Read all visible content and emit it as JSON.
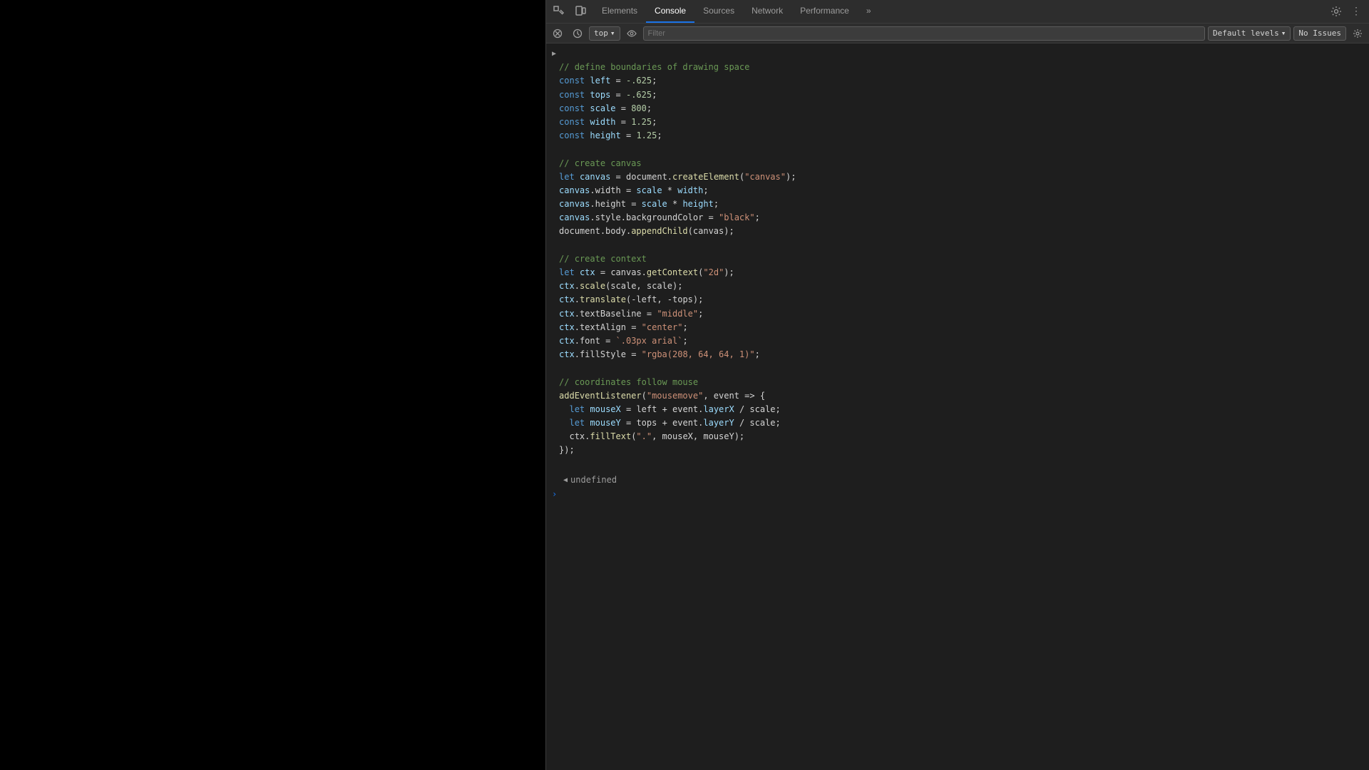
{
  "page": {
    "canvas_bg": "#000000"
  },
  "devtools": {
    "tabs": [
      {
        "id": "elements",
        "label": "Elements",
        "active": false
      },
      {
        "id": "console",
        "label": "Console",
        "active": true
      },
      {
        "id": "sources",
        "label": "Sources",
        "active": false
      },
      {
        "id": "network",
        "label": "Network",
        "active": false
      },
      {
        "id": "performance",
        "label": "Performance",
        "active": false
      }
    ],
    "more_tabs_label": "»",
    "console": {
      "context": "top",
      "filter_placeholder": "Filter",
      "log_levels": "Default levels",
      "log_levels_arrow": "▾",
      "no_issues": "No Issues",
      "settings_icon": "⚙",
      "output": [
        {
          "type": "group",
          "expand": true,
          "lines": [
            {
              "text": "// define boundaries of drawing space",
              "color": "comment"
            },
            {
              "text": "const left = -.625;",
              "parts": [
                {
                  "t": "const ",
                  "c": "keyword"
                },
                {
                  "t": "left",
                  "c": "variable"
                },
                {
                  "t": " = ",
                  "c": "plain"
                },
                {
                  "t": "-.625",
                  "c": "number"
                },
                {
                  "t": ";",
                  "c": "plain"
                }
              ]
            },
            {
              "text": "const tops = -.625;",
              "parts": [
                {
                  "t": "const ",
                  "c": "keyword"
                },
                {
                  "t": "tops",
                  "c": "variable"
                },
                {
                  "t": " = ",
                  "c": "plain"
                },
                {
                  "t": "-.625",
                  "c": "number"
                },
                {
                  "t": ";",
                  "c": "plain"
                }
              ]
            },
            {
              "text": "const scale = 800;",
              "parts": [
                {
                  "t": "const ",
                  "c": "keyword"
                },
                {
                  "t": "scale",
                  "c": "variable"
                },
                {
                  "t": " = ",
                  "c": "plain"
                },
                {
                  "t": "800",
                  "c": "number"
                },
                {
                  "t": ";",
                  "c": "plain"
                }
              ]
            },
            {
              "text": "const width = 1.25;",
              "parts": [
                {
                  "t": "const ",
                  "c": "keyword"
                },
                {
                  "t": "width",
                  "c": "variable"
                },
                {
                  "t": " = ",
                  "c": "plain"
                },
                {
                  "t": "1.25",
                  "c": "number"
                },
                {
                  "t": ";",
                  "c": "plain"
                }
              ]
            },
            {
              "text": "const height = 1.25;",
              "parts": [
                {
                  "t": "const ",
                  "c": "keyword"
                },
                {
                  "t": "height",
                  "c": "variable"
                },
                {
                  "t": " = ",
                  "c": "plain"
                },
                {
                  "t": "1.25",
                  "c": "number"
                },
                {
                  "t": ";",
                  "c": "plain"
                }
              ]
            },
            {
              "text": "",
              "color": "plain"
            },
            {
              "text": "// create canvas",
              "color": "comment"
            },
            {
              "text": "let canvas = document.createElement(\"canvas\");",
              "parts": [
                {
                  "t": "let ",
                  "c": "keyword"
                },
                {
                  "t": "canvas",
                  "c": "variable"
                },
                {
                  "t": " = document.",
                  "c": "plain"
                },
                {
                  "t": "createElement",
                  "c": "function"
                },
                {
                  "t": "(",
                  "c": "plain"
                },
                {
                  "t": "\"canvas\"",
                  "c": "string"
                },
                {
                  "t": ");",
                  "c": "plain"
                }
              ]
            },
            {
              "text": "canvas.width = scale * width;",
              "parts": [
                {
                  "t": "canvas",
                  "c": "variable"
                },
                {
                  "t": ".width = ",
                  "c": "plain"
                },
                {
                  "t": "scale",
                  "c": "variable"
                },
                {
                  "t": " * ",
                  "c": "plain"
                },
                {
                  "t": "width",
                  "c": "variable"
                },
                {
                  "t": ";",
                  "c": "plain"
                }
              ]
            },
            {
              "text": "canvas.height = scale * height;",
              "parts": [
                {
                  "t": "canvas",
                  "c": "variable"
                },
                {
                  "t": ".height = ",
                  "c": "plain"
                },
                {
                  "t": "scale",
                  "c": "variable"
                },
                {
                  "t": " * ",
                  "c": "plain"
                },
                {
                  "t": "height",
                  "c": "variable"
                },
                {
                  "t": ";",
                  "c": "plain"
                }
              ]
            },
            {
              "text": "canvas.style.backgroundColor = \"black\";",
              "parts": [
                {
                  "t": "canvas",
                  "c": "variable"
                },
                {
                  "t": ".style.backgroundColor = ",
                  "c": "plain"
                },
                {
                  "t": "\"black\"",
                  "c": "string"
                },
                {
                  "t": ";",
                  "c": "plain"
                }
              ]
            },
            {
              "text": "document.body.appendChild(canvas);",
              "parts": [
                {
                  "t": "document.body.",
                  "c": "plain"
                },
                {
                  "t": "appendChild",
                  "c": "function"
                },
                {
                  "t": "(canvas);",
                  "c": "plain"
                }
              ]
            },
            {
              "text": "",
              "color": "plain"
            },
            {
              "text": "// create context",
              "color": "comment"
            },
            {
              "text": "let ctx = canvas.getContext(\"2d\");",
              "parts": [
                {
                  "t": "let ",
                  "c": "keyword"
                },
                {
                  "t": "ctx",
                  "c": "variable"
                },
                {
                  "t": " = canvas.",
                  "c": "plain"
                },
                {
                  "t": "getContext",
                  "c": "function"
                },
                {
                  "t": "(",
                  "c": "plain"
                },
                {
                  "t": "\"2d\"",
                  "c": "string"
                },
                {
                  "t": ");",
                  "c": "plain"
                }
              ]
            },
            {
              "text": "ctx.scale(scale, scale);",
              "parts": [
                {
                  "t": "ctx",
                  "c": "variable"
                },
                {
                  "t": ".",
                  "c": "plain"
                },
                {
                  "t": "scale",
                  "c": "function"
                },
                {
                  "t": "(scale, scale);",
                  "c": "plain"
                }
              ]
            },
            {
              "text": "ctx.translate(-left, -tops);",
              "parts": [
                {
                  "t": "ctx",
                  "c": "variable"
                },
                {
                  "t": ".",
                  "c": "plain"
                },
                {
                  "t": "translate",
                  "c": "function"
                },
                {
                  "t": "(-left, -tops);",
                  "c": "plain"
                }
              ]
            },
            {
              "text": "ctx.textBaseline = \"middle\";",
              "parts": [
                {
                  "t": "ctx",
                  "c": "variable"
                },
                {
                  "t": ".textBaseline = ",
                  "c": "plain"
                },
                {
                  "t": "\"middle\"",
                  "c": "string"
                },
                {
                  "t": ";",
                  "c": "plain"
                }
              ]
            },
            {
              "text": "ctx.textAlign = \"center\";",
              "parts": [
                {
                  "t": "ctx",
                  "c": "variable"
                },
                {
                  "t": ".textAlign = ",
                  "c": "plain"
                },
                {
                  "t": "\"center\"",
                  "c": "string"
                },
                {
                  "t": ";",
                  "c": "plain"
                }
              ]
            },
            {
              "text": "ctx.font = `.03px arial`;",
              "parts": [
                {
                  "t": "ctx",
                  "c": "variable"
                },
                {
                  "t": ".font = ",
                  "c": "plain"
                },
                {
                  "t": "`.03px arial`",
                  "c": "string"
                },
                {
                  "t": ";",
                  "c": "plain"
                }
              ]
            },
            {
              "text": "ctx.fillStyle = \"rgba(208, 64, 64, 1)\";",
              "parts": [
                {
                  "t": "ctx",
                  "c": "variable"
                },
                {
                  "t": ".fillStyle = ",
                  "c": "plain"
                },
                {
                  "t": "\"rgba(208, 64, 64, 1)\"",
                  "c": "string"
                },
                {
                  "t": ";",
                  "c": "plain"
                }
              ]
            },
            {
              "text": "",
              "color": "plain"
            },
            {
              "text": "// coordinates follow mouse",
              "color": "comment"
            },
            {
              "text": "addEventListener(\"mousemove\", event => {",
              "parts": [
                {
                  "t": "addEventListener",
                  "c": "function"
                },
                {
                  "t": "(",
                  "c": "plain"
                },
                {
                  "t": "\"mousemove\"",
                  "c": "string"
                },
                {
                  "t": ", event => {",
                  "c": "plain"
                }
              ]
            },
            {
              "text": "  let mouseX = left + event.layerX / scale;",
              "parts": [
                {
                  "t": "  let ",
                  "c": "keyword"
                },
                {
                  "t": "mouseX",
                  "c": "variable"
                },
                {
                  "t": " = left + event.",
                  "c": "plain"
                },
                {
                  "t": "layerX",
                  "c": "property"
                },
                {
                  "t": " / scale;",
                  "c": "plain"
                }
              ]
            },
            {
              "text": "  let mouseY = tops + event.layerY / scale;",
              "parts": [
                {
                  "t": "  let ",
                  "c": "keyword"
                },
                {
                  "t": "mouseY",
                  "c": "variable"
                },
                {
                  "t": " = tops + event.",
                  "c": "plain"
                },
                {
                  "t": "layerY",
                  "c": "property"
                },
                {
                  "t": " / scale;",
                  "c": "plain"
                }
              ]
            },
            {
              "text": "  ctx.fillText(\".\", mouseX, mouseY);",
              "parts": [
                {
                  "t": "  ctx.",
                  "c": "plain"
                },
                {
                  "t": "fillText",
                  "c": "function"
                },
                {
                  "t": "(",
                  "c": "plain"
                },
                {
                  "t": "\".\"",
                  "c": "string"
                },
                {
                  "t": ", mouseX, mouseY);",
                  "c": "plain"
                }
              ]
            },
            {
              "text": "});",
              "color": "plain"
            }
          ]
        }
      ],
      "result": "undefined"
    }
  }
}
